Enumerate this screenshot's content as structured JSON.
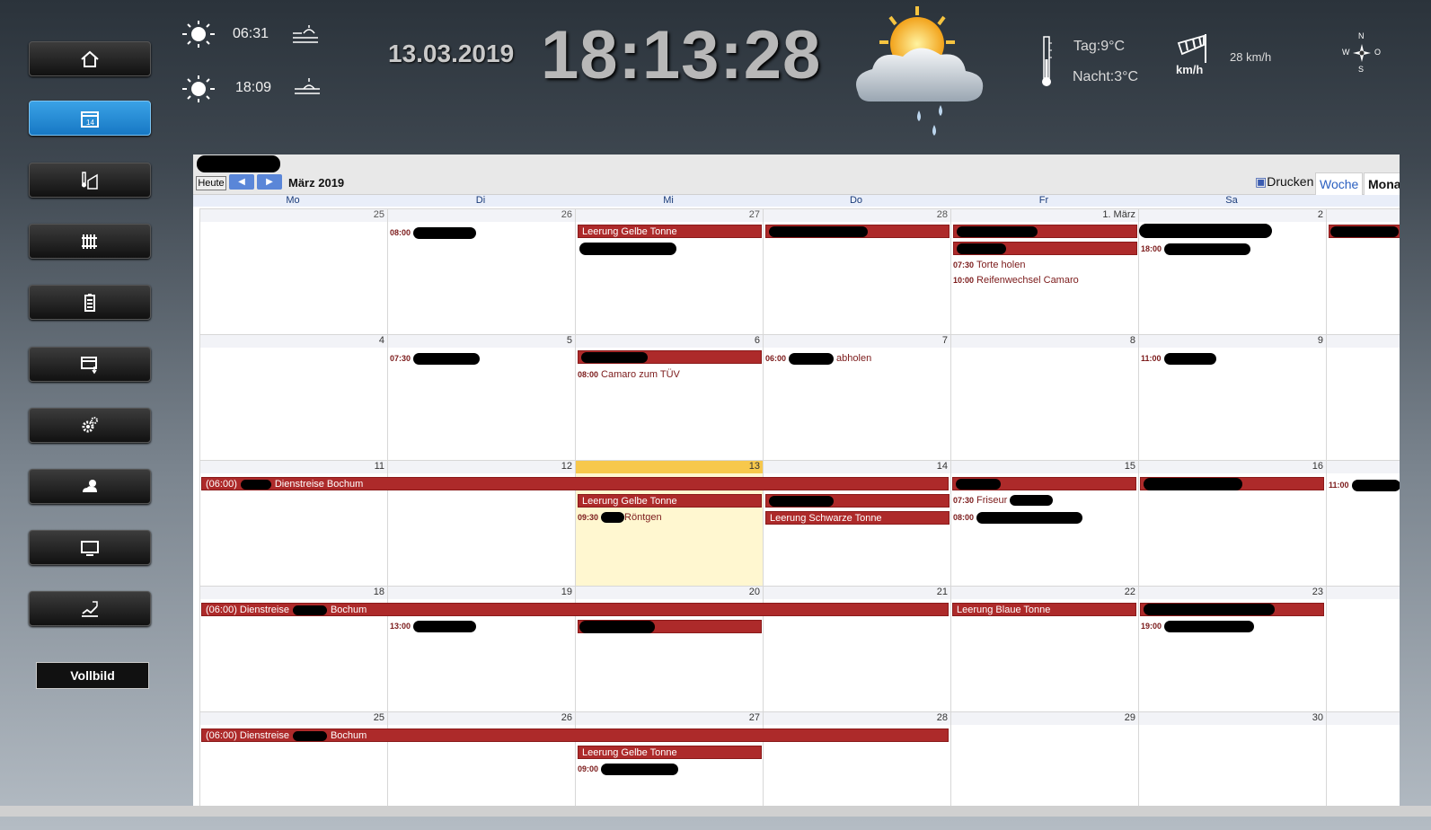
{
  "sidebar": {
    "items": [
      {
        "icon": "home-icon",
        "active": false
      },
      {
        "icon": "calendar-icon",
        "active": true,
        "text": "14"
      },
      {
        "icon": "thermometer-house-icon",
        "active": false
      },
      {
        "icon": "radiator-icon",
        "active": false
      },
      {
        "icon": "battery-icon",
        "active": false
      },
      {
        "icon": "window-shutter-icon",
        "active": false
      },
      {
        "icon": "gears-icon",
        "active": false
      },
      {
        "icon": "weather-icon",
        "active": false
      },
      {
        "icon": "monitor-icon",
        "active": false
      },
      {
        "icon": "chart-icon",
        "active": false
      }
    ],
    "fullscreen_label": "Vollbild"
  },
  "header": {
    "sunrise": "06:31",
    "sunset": "18:09",
    "date": "13.03.2019",
    "time": "18:13:28",
    "temp_day": "Tag:9°C",
    "temp_night": "Nacht:3°C",
    "wind_unit": "km/h",
    "wind_speed": "28 km/h",
    "compass": {
      "n": "N",
      "s": "S",
      "w": "W",
      "o": "O"
    }
  },
  "calendar": {
    "today_btn": "Heute",
    "month_title": "März 2019",
    "print_label": "Drucken",
    "tab_week": "Woche",
    "tab_month": "Mona",
    "daynames": [
      "Mo",
      "Di",
      "Mi",
      "Do",
      "Fr",
      "Sa"
    ],
    "weeks": [
      {
        "days": [
          "25",
          "26",
          "27",
          "28",
          "1. März",
          "2"
        ]
      },
      {
        "days": [
          "4",
          "5",
          "6",
          "7",
          "8",
          "9"
        ]
      },
      {
        "days": [
          "11",
          "12",
          "13",
          "14",
          "15",
          "16"
        ]
      },
      {
        "days": [
          "18",
          "19",
          "20",
          "21",
          "22",
          "23"
        ]
      },
      {
        "days": [
          "25",
          "26",
          "27",
          "28",
          "29",
          "30"
        ]
      }
    ],
    "events": {
      "w1_di": "08:00",
      "w1_mi": "Leerung Gelbe Tonne",
      "w1_fr_time1": "07:30",
      "w1_fr_text1": "Torte holen",
      "w1_fr_time2": "10:00",
      "w1_fr_text2": "Reifenwechsel Camaro",
      "w1_sa": "18:00",
      "w2_di": "07:30",
      "w2_mi_time": "08:00",
      "w2_mi_text": "Camaro zum TÜV",
      "w2_do_time": "06:00",
      "w2_do_text": "abholen",
      "w2_sa": "11:00",
      "w3_span": "(06:00)",
      "w3_span_text": "Dienstreise Bochum",
      "w3_mi": "Leerung Gelbe Tonne",
      "w3_mi_time": "09:30",
      "w3_mi_text": "Röntgen",
      "w3_do": "Leerung Schwarze Tonne",
      "w3_fr_time1": "07:30",
      "w3_fr_text1": "Friseur",
      "w3_fr_time2": "08:00",
      "w3_so": "11:00",
      "w4_span": "(06:00) Dienstreise",
      "w4_span_tail": "Bochum",
      "w4_di": "13:00",
      "w4_fr": "Leerung Blaue Tonne",
      "w4_sa": "19:00",
      "w5_span": "(06:00) Dienstreise",
      "w5_span_tail": "Bochum",
      "w5_mi": "Leerung Gelbe Tonne",
      "w5_mi_time": "09:00"
    }
  },
  "colors": {
    "event_red": "#ad2a2a",
    "today_yellow": "#f7c84c",
    "accent_blue": "#1778c4"
  }
}
